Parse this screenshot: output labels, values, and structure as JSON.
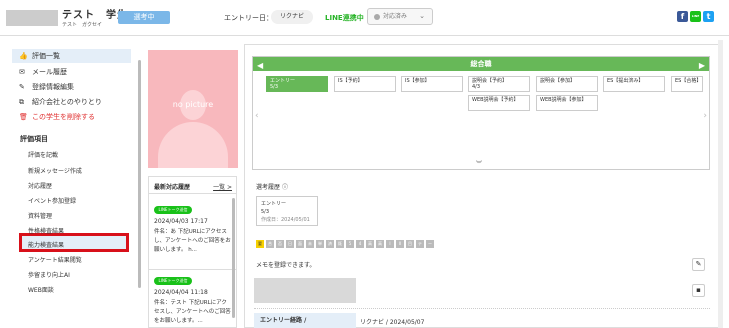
{
  "header": {
    "name": "テスト　学生",
    "kana": "テスト　ガクセイ",
    "status_badge": "選考中",
    "entry_date": "エントリー日：2024/5/7",
    "source_badge": "リクナビ",
    "line_status": "LINE連携中",
    "response_select": "対応済み",
    "social": [
      "f",
      "LINE",
      "t"
    ]
  },
  "sidebar": {
    "items": [
      {
        "label": "評価一覧",
        "icon": "thumbs-up-icon"
      },
      {
        "label": "メール履歴",
        "icon": "mail-icon"
      },
      {
        "label": "登録情報編集",
        "icon": "pencil-icon"
      },
      {
        "label": "紹介会社とのやりとり",
        "icon": "copy-icon"
      },
      {
        "label": "この学生を削除する",
        "icon": "trash-icon"
      }
    ],
    "eval_title": "評価項目",
    "eval_items": [
      "評価を記載",
      "新規メッセージ作成",
      "対応履歴",
      "イベント参加登録",
      "資料管理",
      "性格検査結果",
      "能力検査結果",
      "アンケート結果閲覧",
      "歩留まり向上AI",
      "WEB面談"
    ]
  },
  "photo": {
    "label": "no picture"
  },
  "history": {
    "title": "最新対応履歴",
    "more": "一覧 >",
    "entries": [
      {
        "tag": "LINEトーク送信",
        "time": "2024/04/03 17:17",
        "text": "件名：あ 下記URLにアクセスし、アンケートへのご回答をお願いします。 h..."
      },
      {
        "tag": "LINEトーク送信",
        "time": "2024/04/04 11:18",
        "text": "件名：テスト 下記URLにアクセスし、アンケートへのご回答をお願いします。..."
      }
    ]
  },
  "flow": {
    "title": "総合職",
    "stages": [
      {
        "label": "エントリー",
        "sub": "5/3",
        "current": true
      },
      {
        "label": "IS【予約】",
        "sub": ""
      },
      {
        "label": "IS【参加】",
        "sub": ""
      },
      {
        "label": "説明会【予約】",
        "sub": "4/3"
      },
      {
        "label": "説明会【参加】",
        "sub": ""
      },
      {
        "label": "ES【提出済み】",
        "sub": ""
      },
      {
        "label": "ES【合格】",
        "sub": ""
      },
      {
        "label": "WEB説明会【予約】",
        "sub": ""
      },
      {
        "label": "WEB説明会【参加】",
        "sub": ""
      }
    ]
  },
  "selection": {
    "title": "選考履歴",
    "card_title": "エントリー",
    "card_date": "5/3",
    "card_created": "作成日：2024/05/01"
  },
  "tags": [
    "要",
    "合",
    "否",
    "日",
    "面",
    "未",
    "単",
    "済",
    "既",
    "5",
    "4",
    "高",
    "高",
    "Ⅰ",
    "Ⅱ",
    "目",
    "テ",
    "ー"
  ],
  "memo": {
    "placeholder": "メモを登録できます。"
  },
  "route": {
    "label": "エントリー経路 /",
    "value": "リクナビ / 2024/05/07"
  },
  "colors": {
    "accent": "#67b858",
    "badge": "#7bb7e8",
    "highlight": "#d8101a",
    "line_green": "#19c119"
  }
}
